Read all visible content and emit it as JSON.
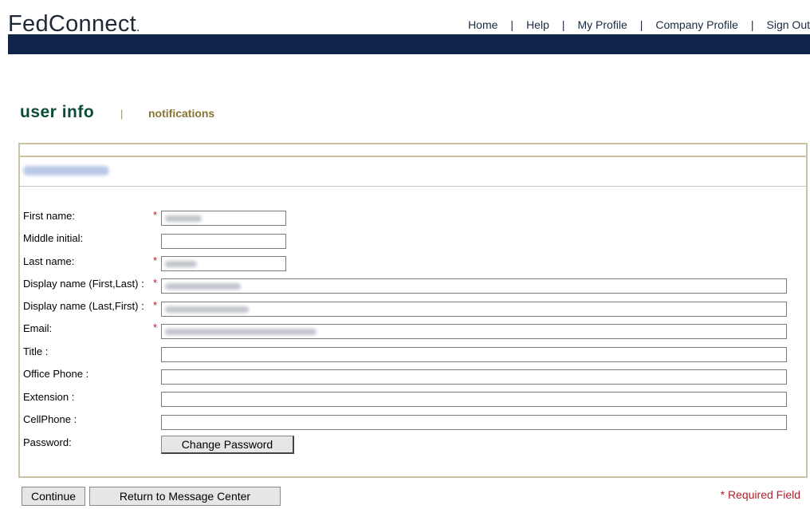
{
  "brand": {
    "logo_text": "FedConnect",
    "logo_mark": "."
  },
  "topnav": {
    "items": [
      {
        "label": "Home"
      },
      {
        "label": "Help"
      },
      {
        "label": "My Profile"
      },
      {
        "label": "Company Profile"
      },
      {
        "label": "Sign Out"
      }
    ],
    "separator": "|"
  },
  "tabs": {
    "active": "user info",
    "separator": "|",
    "other": "notifications"
  },
  "form": {
    "labels": {
      "first_name": "First name:",
      "middle_initial": "Middle initial:",
      "last_name": "Last name:",
      "display_first_last": "Display name (First,Last) :",
      "display_last_first": "Display name (Last,First) :",
      "email": "Email:",
      "title": "Title :",
      "office_phone": "Office Phone :",
      "extension": "Extension :",
      "cellphone": "CellPhone :",
      "password": "Password:"
    },
    "required_mark": "*",
    "change_password_label": "Change Password"
  },
  "footer": {
    "continue_label": "Continue",
    "return_label": "Return to Message Center",
    "required_note": "* Required Field"
  },
  "colors": {
    "banner": "#0e2449",
    "active_tab": "#0e4a3a",
    "inactive_tab": "#8a7434",
    "panel_border": "#c9c2a4",
    "required": "#b3202a"
  }
}
